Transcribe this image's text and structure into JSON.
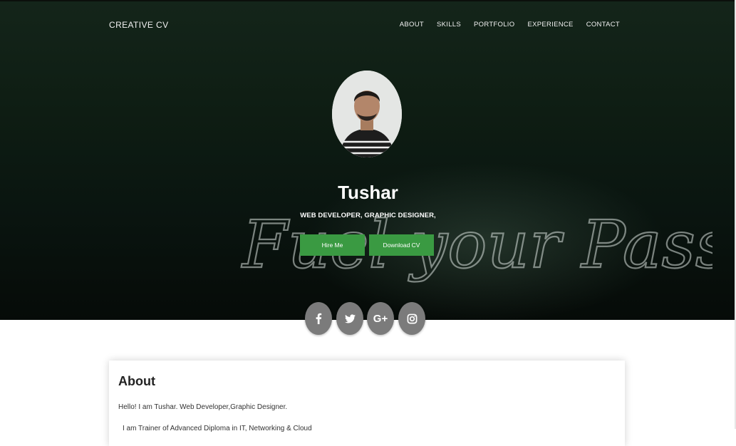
{
  "header": {
    "brand": "CREATIVE CV",
    "nav": [
      "ABOUT",
      "SKILLS",
      "PORTFOLIO",
      "EXPERIENCE",
      "CONTACT"
    ]
  },
  "hero": {
    "name": "Tushar",
    "role": "WEB DEVELOPER, GRAPHIC DESIGNER,",
    "hire_label": "Hire Me",
    "download_label": "Download CV",
    "background_text": "Fuel your Passion",
    "accent_color": "#3a9a42",
    "social": [
      {
        "icon": "facebook-icon",
        "glyph": "f"
      },
      {
        "icon": "twitter-icon",
        "glyph": "t"
      },
      {
        "icon": "google-plus-icon",
        "glyph": "G+"
      },
      {
        "icon": "instagram-icon",
        "glyph": "ig"
      }
    ]
  },
  "about": {
    "title": "About",
    "text": "Hello! I am Tushar. Web Developer,Graphic Designer.",
    "text2": "I am Trainer of Advanced Diploma in IT, Networking & Cloud"
  }
}
